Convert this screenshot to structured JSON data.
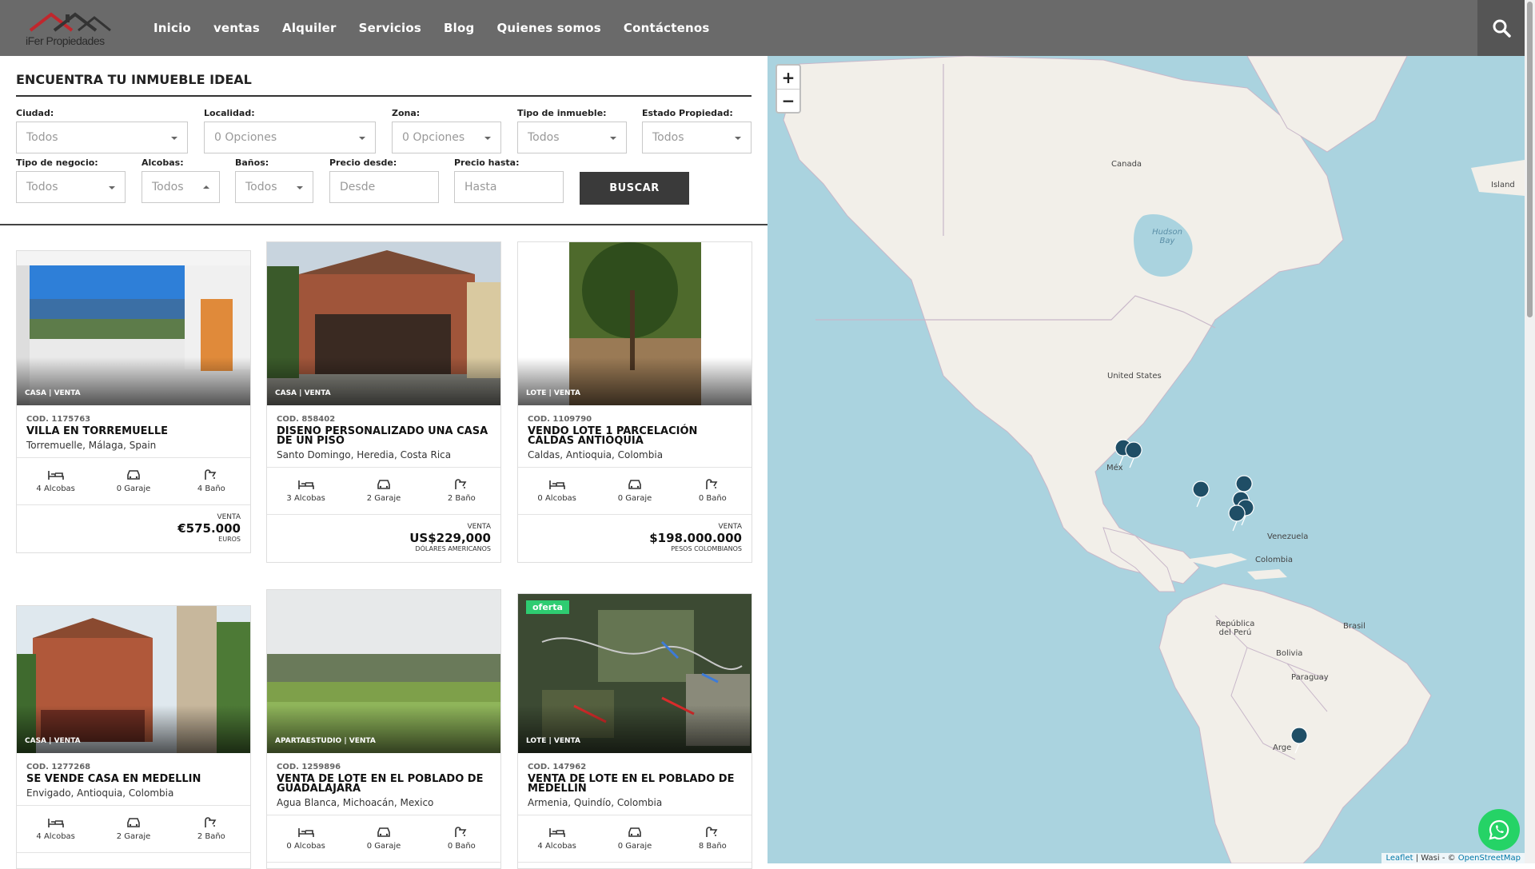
{
  "brand": {
    "logo_text": "iFer Propiedades"
  },
  "nav": [
    "Inicio",
    "ventas",
    "Alquiler",
    "Servicios",
    "Blog",
    "Quienes somos",
    "Contáctenos"
  ],
  "search": {
    "heading": "ENCUENTRA TU INMUEBLE IDEAL",
    "button": "BUSCAR",
    "fields": {
      "ciudad": {
        "label": "Ciudad:",
        "value": "Todos"
      },
      "localidad": {
        "label": "Localidad:",
        "value": "0 Opciones"
      },
      "zona": {
        "label": "Zona:",
        "value": "0 Opciones"
      },
      "tipo_inmueble": {
        "label": "Tipo de inmueble:",
        "value": "Todos"
      },
      "estado": {
        "label": "Estado Propiedad:",
        "value": "Todos"
      },
      "tipo_negocio": {
        "label": "Tipo de negocio:",
        "value": "Todos"
      },
      "alcobas": {
        "label": "Alcobas:",
        "value": "Todos"
      },
      "banos": {
        "label": "Baños:",
        "value": "Todos"
      },
      "precio_desde": {
        "label": "Precio desde:",
        "placeholder": "Desde"
      },
      "precio_hasta": {
        "label": "Precio hasta:",
        "placeholder": "Hasta"
      }
    }
  },
  "listings": [
    {
      "tag": "CASA | VENTA",
      "cod": "COD. 1175763",
      "title": "VILLA EN TORREMUELLE",
      "location": "Torremuelle, Málaga, Spain",
      "beds": "4 Alcobas",
      "garage": "0 Garaje",
      "baths": "4 Baño",
      "price_kind": "VENTA",
      "price": "€575.000",
      "currency": "EUROS"
    },
    {
      "tag": "CASA | VENTA",
      "cod": "COD. 858402",
      "title": "DISENO PERSONALIZADO UNA CASA DE UN PISO",
      "location": "Santo Domingo, Heredia, Costa Rica",
      "beds": "3 Alcobas",
      "garage": "2 Garaje",
      "baths": "2 Baño",
      "price_kind": "VENTA",
      "price": "US$229,000",
      "currency": "DÓLARES AMERICANOS"
    },
    {
      "tag": "LOTE | VENTA",
      "cod": "COD. 1109790",
      "title": "VENDO LOTE 1 PARCELACIÓN CALDAS ANTIOQUIA",
      "location": "Caldas, Antioquia, Colombia",
      "beds": "0 Alcobas",
      "garage": "0 Garaje",
      "baths": "0 Baño",
      "price_kind": "VENTA",
      "price": "$198.000.000",
      "currency": "PESOS COLOMBIANOS"
    },
    {
      "tag": "CASA | VENTA",
      "cod": "COD. 1277268",
      "title": "SE VENDE CASA EN MEDELLIN",
      "location": "Envigado, Antioquia, Colombia",
      "beds": "4 Alcobas",
      "garage": "2 Garaje",
      "baths": "2 Baño"
    },
    {
      "tag": "APARTAESTUDIO | VENTA",
      "cod": "COD. 1259896",
      "title": "VENTA DE LOTE EN EL POBLADO DE GUADALAJARA",
      "location": "Agua Blanca, Michoacán, Mexico",
      "beds": "0 Alcobas",
      "garage": "0 Garaje",
      "baths": "0 Baño"
    },
    {
      "tag": "LOTE | VENTA",
      "badge": "oferta",
      "cod": "COD. 147962",
      "title": "VENTA DE LOTE EN EL POBLADO DE MEDELLIN",
      "location": "Armenia, Quindío, Colombia",
      "beds": "4 Alcobas",
      "garage": "0 Garaje",
      "baths": "8 Baño"
    }
  ],
  "map": {
    "labels": [
      "Canada",
      "Island",
      "Hudson Bay",
      "United States",
      "Méx",
      "Venezuela",
      "Colombia",
      "Brasil",
      "República del Perú",
      "Bolivia",
      "Paraguay",
      "Arge"
    ],
    "attribution": {
      "leaflet": "Leaflet",
      "sep": " | Wasi - © ",
      "osm": "OpenStreetMap"
    },
    "colors": {
      "water": "#aad3df",
      "land": "#f2efe9",
      "marker": "#1f4e66"
    }
  },
  "colors": {
    "header_bg": "#6a6a6a",
    "button_bg": "#3a3a3a",
    "whatsapp": "#25d366"
  }
}
